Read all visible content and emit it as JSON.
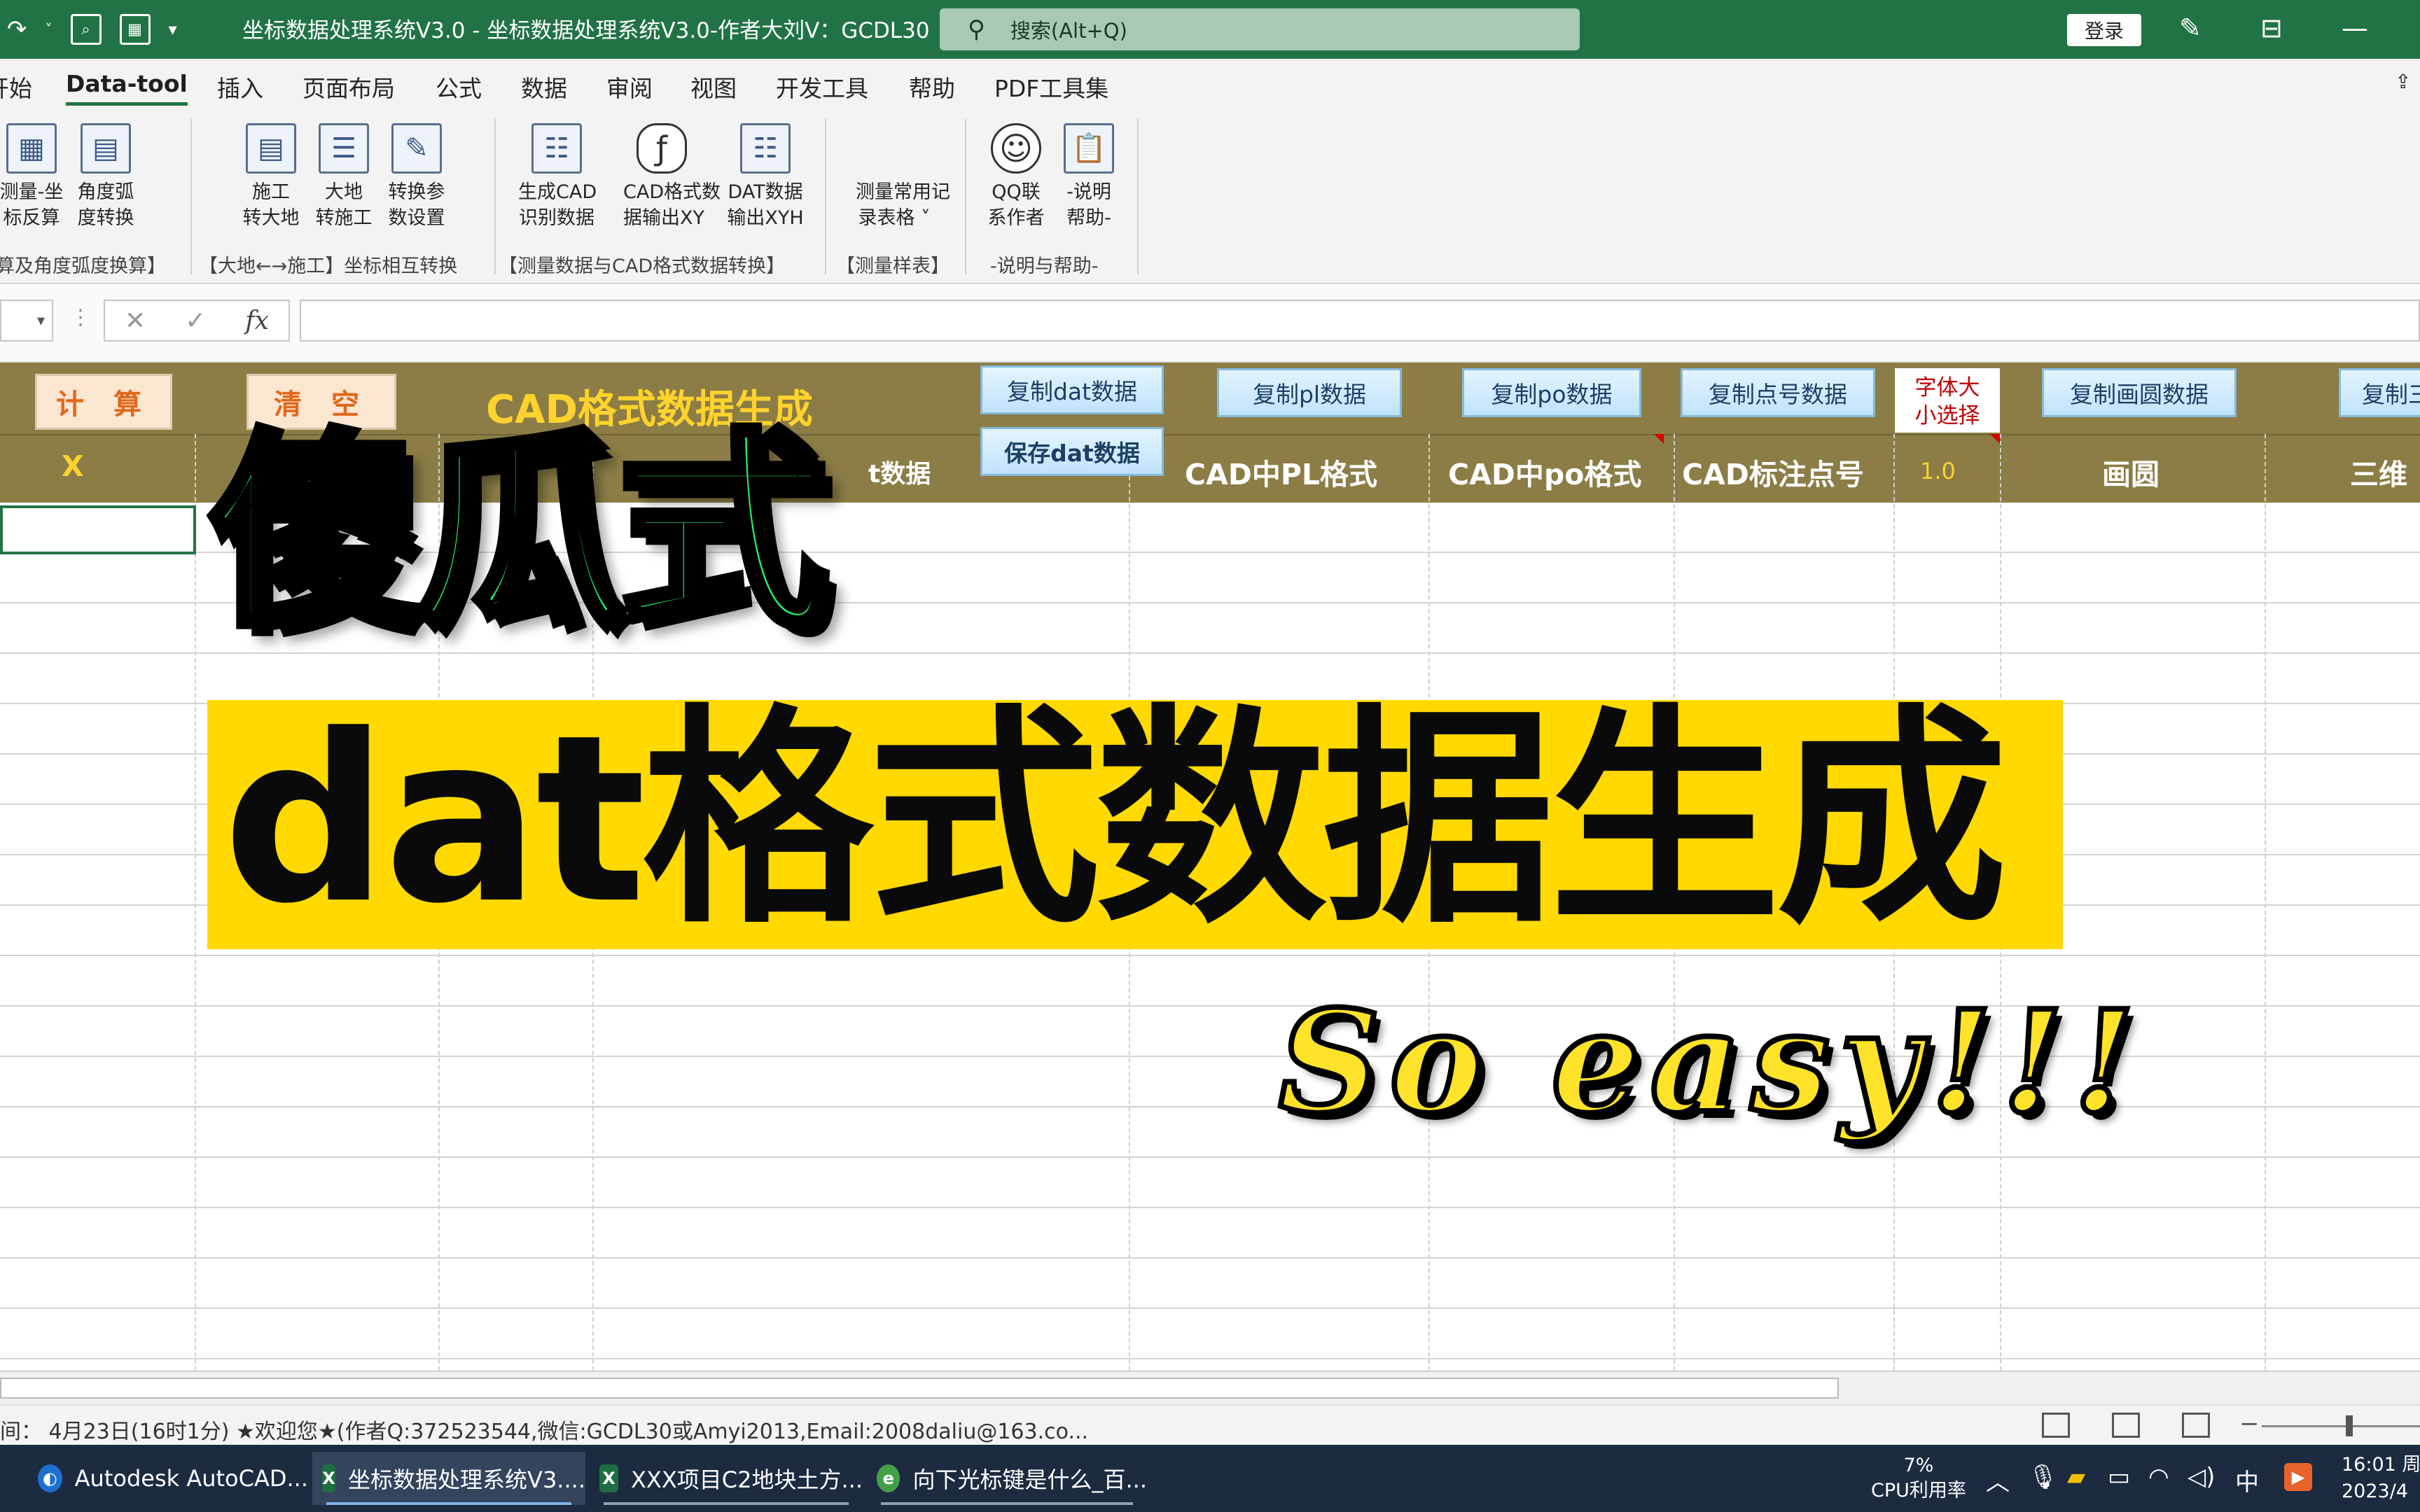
{
  "titlebar": {
    "title": "坐标数据处理系统V3.0  -  坐标数据处理系统V3.0-作者大刘V：GCDL30",
    "search_placeholder": "搜索(Alt+Q)",
    "login": "登录"
  },
  "ribbon_tabs": [
    "开始",
    "Data-tool",
    "插入",
    "页面布局",
    "公式",
    "数据",
    "审阅",
    "视图",
    "开发工具",
    "帮助",
    "PDF工具集"
  ],
  "ribbon": {
    "buttons": [
      {
        "l1": "测量-坐",
        "l2": "标反算"
      },
      {
        "l1": "角度弧",
        "l2": "度转换"
      },
      {
        "l1": "施工",
        "l2": "转大地"
      },
      {
        "l1": "大地",
        "l2": "转施工"
      },
      {
        "l1": "转换参",
        "l2": "数设置"
      },
      {
        "l1": "生成CAD",
        "l2": "识别数据"
      },
      {
        "l1": "CAD格式数",
        "l2": "据输出XY"
      },
      {
        "l1": "DAT数据",
        "l2": "输出XYH"
      },
      {
        "l1": "测量常用记",
        "l2": "录表格 ˅"
      },
      {
        "l1": "QQ联",
        "l2": "系作者"
      },
      {
        "l1": "-说明",
        "l2": "帮助-"
      }
    ],
    "groups": [
      "算及角度弧度换算】",
      "【大地←→施工】坐标相互转换",
      "【测量数据与CAD格式数据转换】",
      "【测量样表】",
      "-说明与帮助-"
    ]
  },
  "formula_bar": {
    "fx": "fx"
  },
  "sheet": {
    "calc_btn": "计 算",
    "clear_btn": "清 空",
    "caption": "CAD格式数据生成",
    "copy_dat": "复制dat数据",
    "save_dat": "保存dat数据",
    "copy_pl": "复制pl数据",
    "copy_po": "复制po数据",
    "copy_pt": "复制点号数据",
    "font_size_l1": "字体大",
    "font_size_l2": "小选择",
    "copy_circle": "复制画圆数据",
    "copy_3d": "复制三",
    "headers": {
      "x": "X",
      "dat": "t数据",
      "pl": "CAD中PL格式",
      "po": "CAD中po格式",
      "pt": "CAD标注点号",
      "font_val": "1.0",
      "circle": "画圆",
      "threed": "三维"
    }
  },
  "overlay": {
    "line1": "傻瓜式",
    "line2": "dat格式数据生成",
    "line3": "So easy!!!"
  },
  "status": {
    "text": "间：  4月23日(16时1分) ★欢迎您★(作者Q:372523544,微信:GCDL30或Amyi2013,Email:2008daliu@163.co..."
  },
  "taskbar": {
    "tasks": [
      "Autodesk AutoCAD...",
      "坐标数据处理系统V3....",
      "XXX项目C2地块土方...",
      "向下光标键是什么_百..."
    ],
    "cpu_pct": "7%",
    "cpu_label": "CPU利用率",
    "ime": "中",
    "time": "16:01 周",
    "date": "2023/4"
  },
  "colors": {
    "excel_green": "#217346",
    "header_olive": "#8b7d45",
    "overlay_green": "#1ef06c",
    "overlay_yellow": "#ffd900"
  }
}
